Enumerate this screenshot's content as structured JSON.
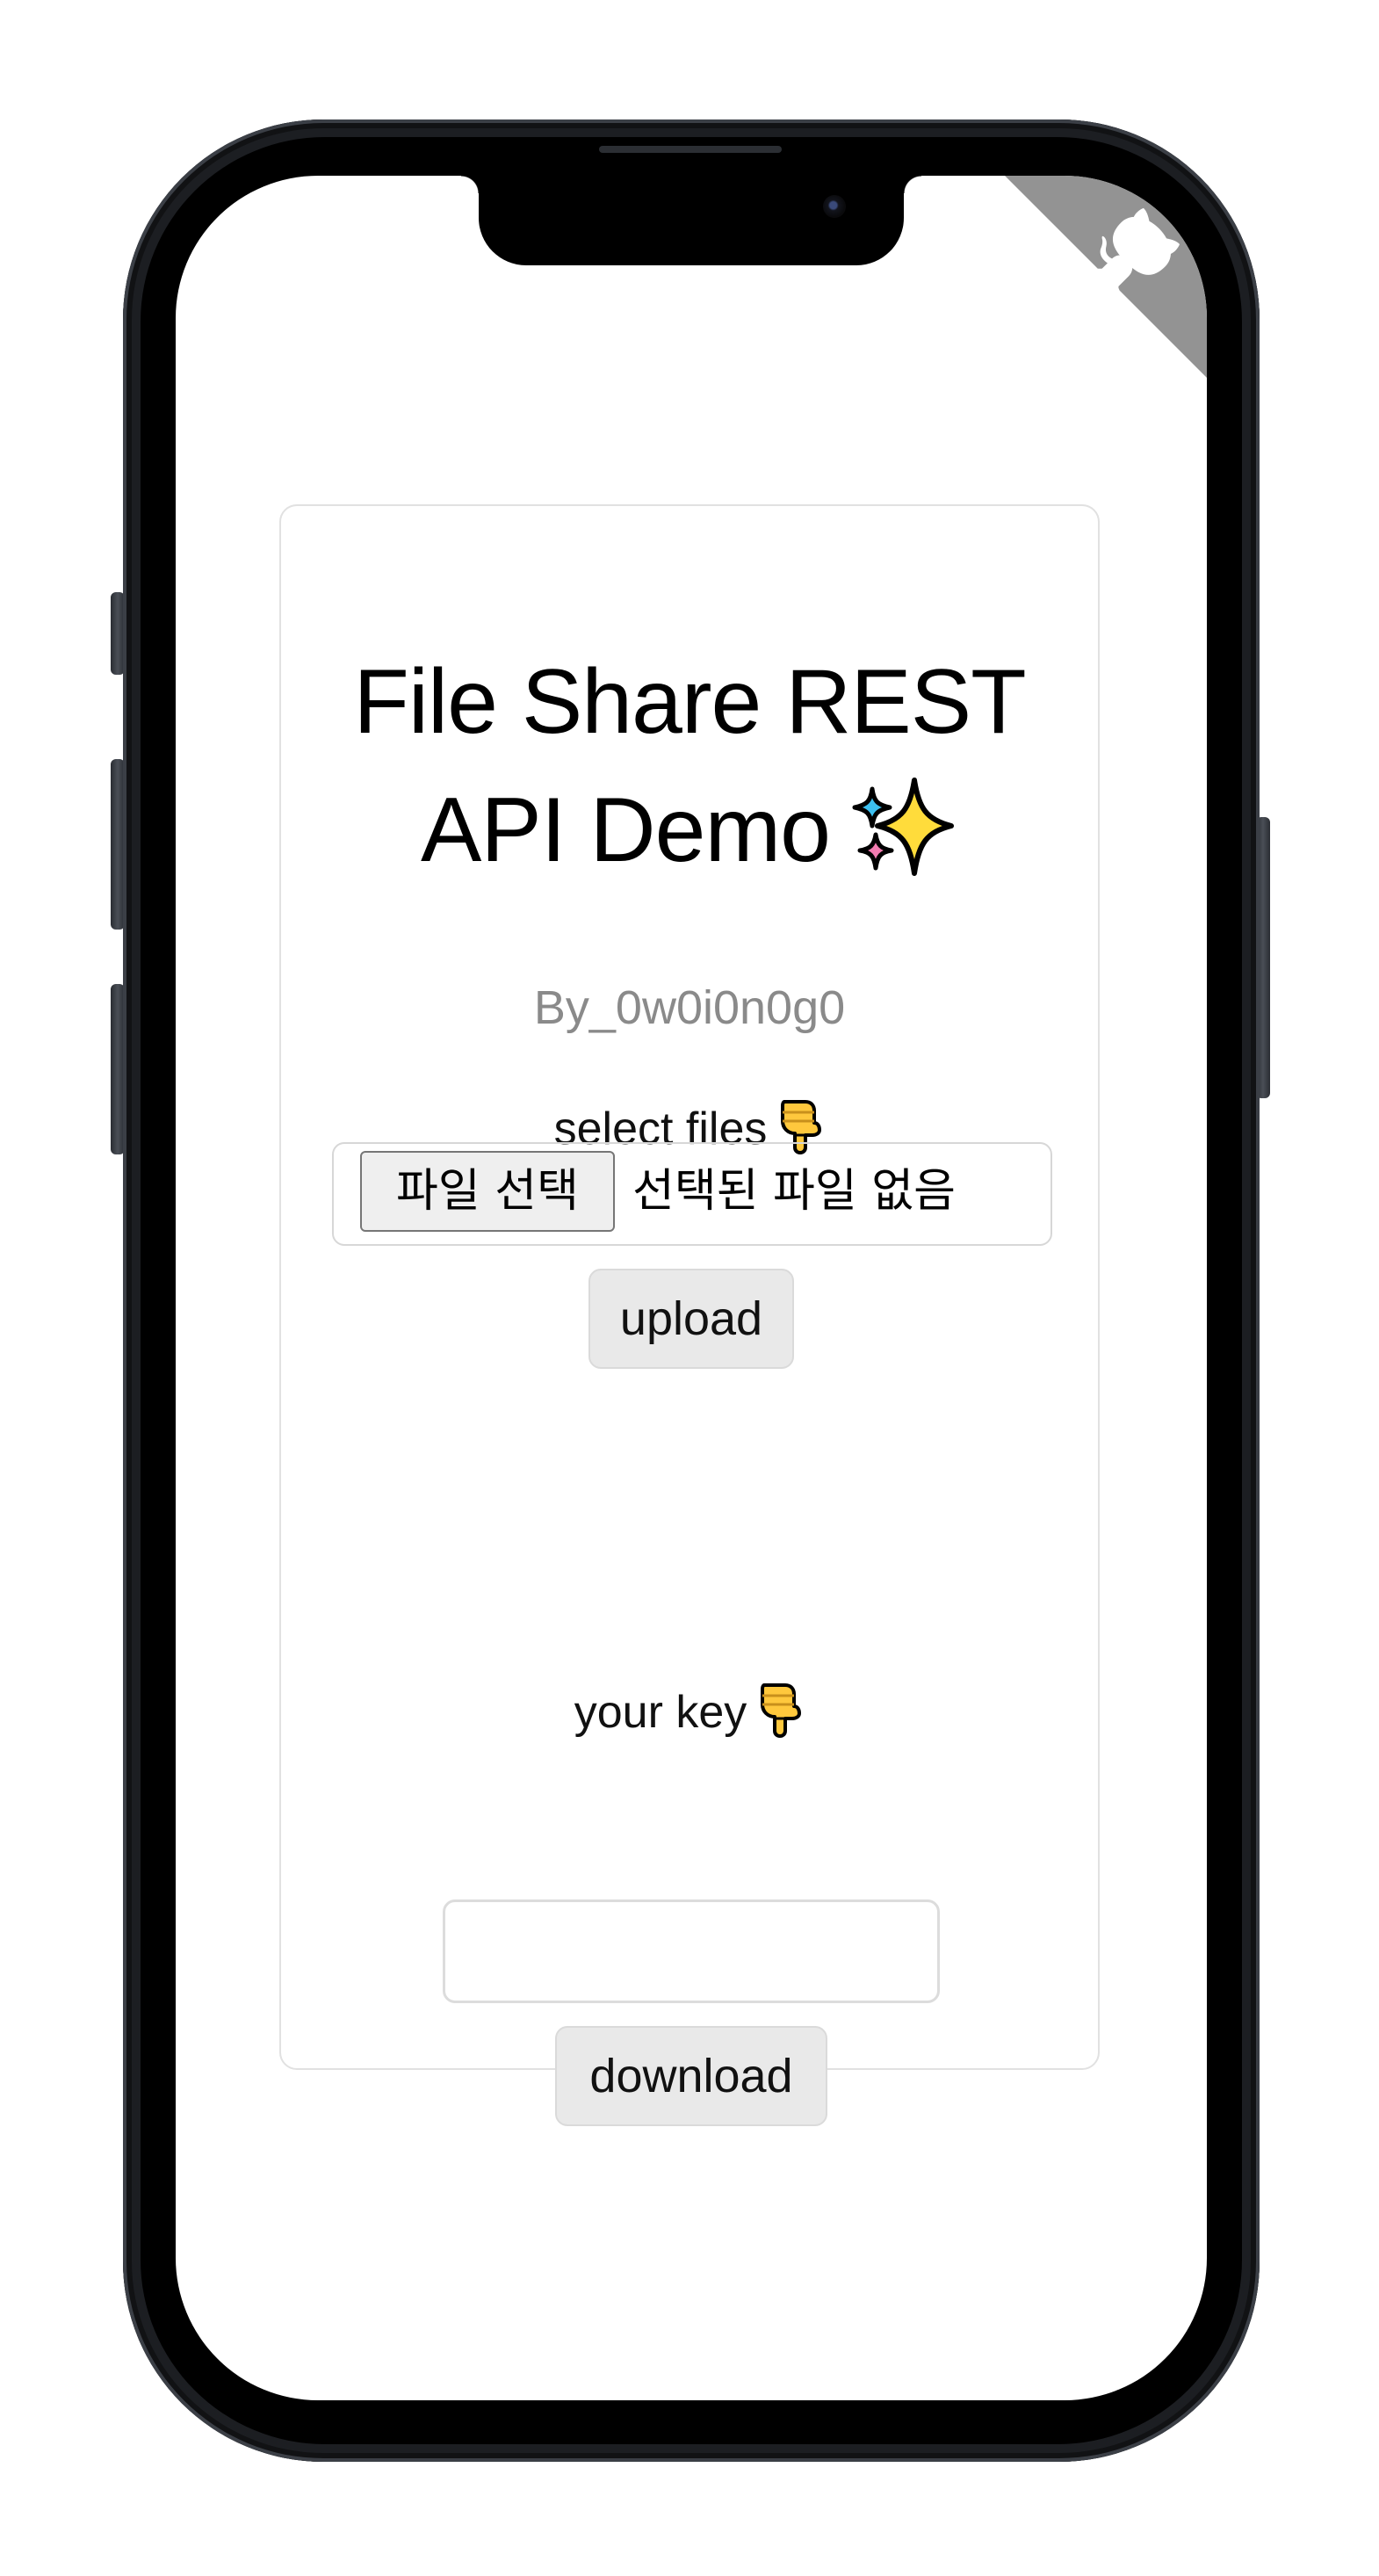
{
  "page": {
    "title_line1": "File Share REST",
    "title_line2": "API Demo",
    "title_emoji": "sparkles",
    "byline": "By_0w0i0n0g0"
  },
  "upload": {
    "label": "select files",
    "label_emoji": "backhand-index-pointing-down",
    "file_button_label": "파일 선택",
    "file_status": "선택된 파일 없음",
    "button_label": "upload"
  },
  "download": {
    "label": "your key",
    "label_emoji": "backhand-index-pointing-down",
    "key_value": "",
    "button_label": "download"
  },
  "corner": {
    "icon": "github-octocat-icon",
    "color": "#939393"
  },
  "colors": {
    "card_border": "#e1e1e1",
    "button_bg": "#e9e9e9",
    "byline": "#8a8a8a"
  }
}
